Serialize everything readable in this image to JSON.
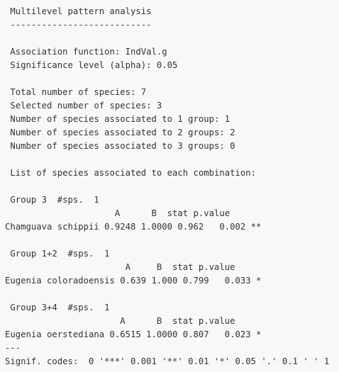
{
  "console_output": {
    "lines": [
      " Multilevel pattern analysis",
      " ---------------------------",
      " Association function: IndVal.g",
      " Significance level (alpha): 0.05",
      " Total number of species: 7",
      " Selected number of species: 3",
      " Number of species associated to 1 group: 1",
      " Number of species associated to 2 groups: 2",
      " Number of species associated to 3 groups: 0",
      " List of species associated to each combination:",
      " Group 3  #sps.  1",
      "                     A      B  stat p.value",
      "Chamguava schippii 0.9248 1.0000 0.962   0.002 **",
      " Group 1+2  #sps.  1",
      "                       A     B  stat p.value",
      "Eugenia coloradoensis 0.639 1.000 0.799   0.033 *",
      " Group 3+4  #sps.  1",
      "                      A      B  stat p.value",
      "Eugenia oerstediana 0.6515 1.0000 0.807   0.023 *",
      "---",
      "Signif. codes:  0 '***' 0.001 '**' 0.01 '*' 0.05 '.' 0.1 ' ' 1"
    ]
  }
}
